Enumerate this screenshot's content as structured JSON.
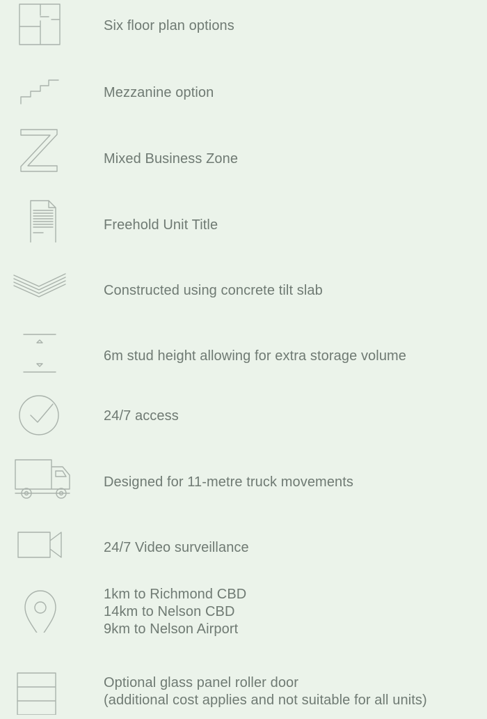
{
  "features": [
    {
      "icon": "floor-plan-icon",
      "lines": [
        "Six floor plan options"
      ]
    },
    {
      "icon": "stairs-icon",
      "lines": [
        "Mezzanine option"
      ]
    },
    {
      "icon": "zone-z-icon",
      "lines": [
        "Mixed Business Zone"
      ]
    },
    {
      "icon": "document-icon",
      "lines": [
        "Freehold Unit Title"
      ]
    },
    {
      "icon": "layers-icon",
      "lines": [
        "Constructed using concrete tilt slab"
      ]
    },
    {
      "icon": "height-icon",
      "lines": [
        "6m stud height allowing for extra storage volume"
      ]
    },
    {
      "icon": "check-circle-icon",
      "lines": [
        "24/7 access"
      ]
    },
    {
      "icon": "truck-icon",
      "lines": [
        "Designed for 11-metre truck movements"
      ]
    },
    {
      "icon": "video-camera-icon",
      "lines": [
        "24/7 Video surveillance"
      ]
    },
    {
      "icon": "location-pin-icon",
      "lines": [
        "1km to Richmond CBD",
        "14km to Nelson CBD",
        "9km to Nelson Airport"
      ]
    },
    {
      "icon": "roller-door-icon",
      "lines": [
        "Optional glass panel roller door",
        "(additional cost applies and not suitable for all units)"
      ]
    }
  ],
  "colors": {
    "background": "#ebf3ea",
    "text": "#6f7a73",
    "icon_stroke": "#a9b2ab"
  }
}
